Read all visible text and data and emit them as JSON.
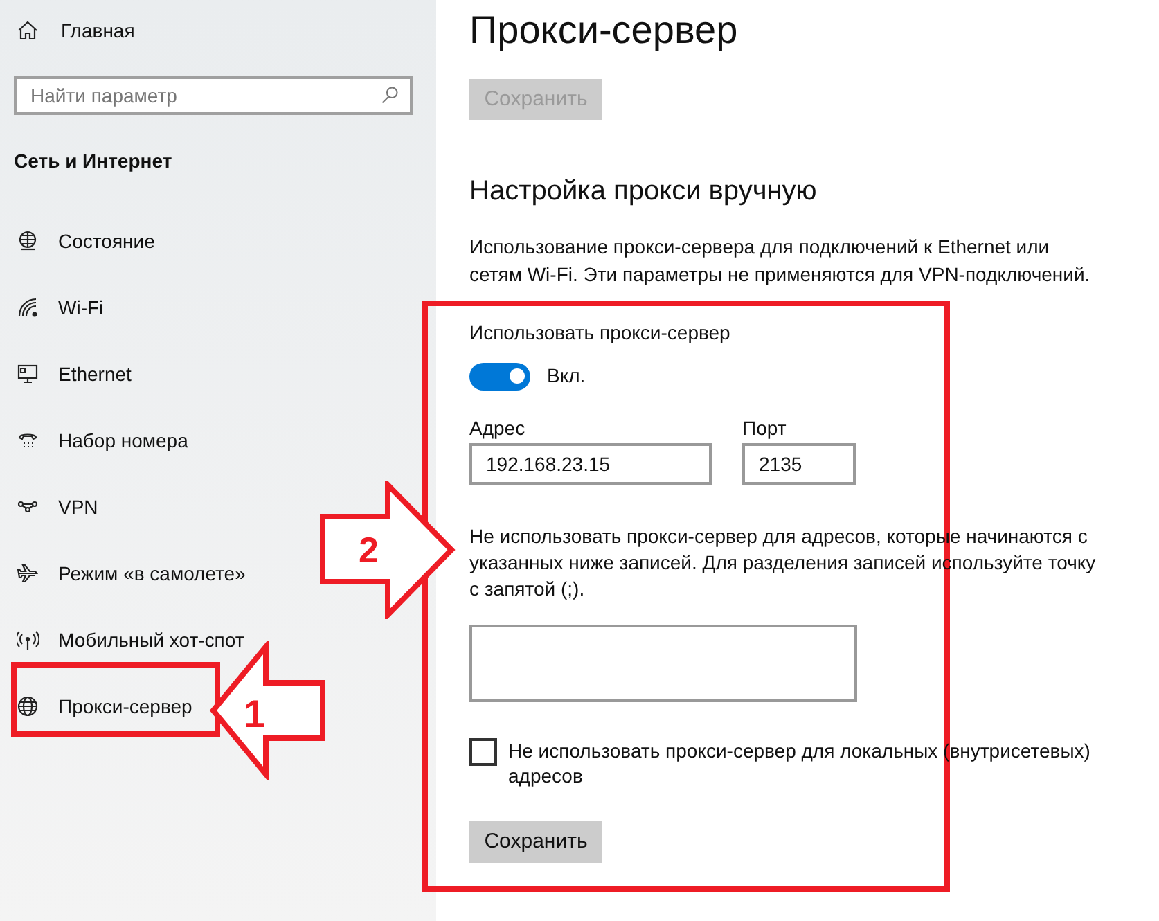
{
  "sidebar": {
    "home": "Главная",
    "search": {
      "placeholder": "Найти параметр"
    },
    "section": "Сеть и Интернет",
    "items": [
      {
        "label": "Состояние"
      },
      {
        "label": "Wi-Fi"
      },
      {
        "label": "Ethernet"
      },
      {
        "label": "Набор номера"
      },
      {
        "label": "VPN"
      },
      {
        "label": "Режим «в самолете»"
      },
      {
        "label": "Мобильный хот-спот"
      },
      {
        "label": "Прокси-сервер"
      }
    ]
  },
  "page": {
    "title": "Прокси-сервер",
    "top_button": {
      "label": "Сохранить",
      "disabled": true
    },
    "manual": {
      "heading": "Настройка прокси вручную",
      "description": "Использование прокси-сервера для подключений к Ethernet или сетям Wi-Fi. Эти параметры не применяются для VPN-подключений.",
      "use_proxy": {
        "label": "Использовать прокси-сервер",
        "on": true,
        "state_text": "Вкл."
      },
      "address": {
        "label": "Адрес",
        "value": "192.168.23.15"
      },
      "port": {
        "label": "Порт",
        "value": "2135"
      },
      "exceptions": {
        "label": "Не использовать прокси-сервер для адресов, которые начинаются с указанных ниже записей. Для разделения записей используйте точку с запятой (;)."
      },
      "local": {
        "label": "Не использовать прокси-сервер для локальных (внутрисетевых) адресов",
        "checked": false
      },
      "save_button": {
        "label": "Сохранить",
        "disabled": false
      }
    }
  },
  "annotations": [
    {
      "label": "1"
    },
    {
      "label": "2"
    }
  ]
}
